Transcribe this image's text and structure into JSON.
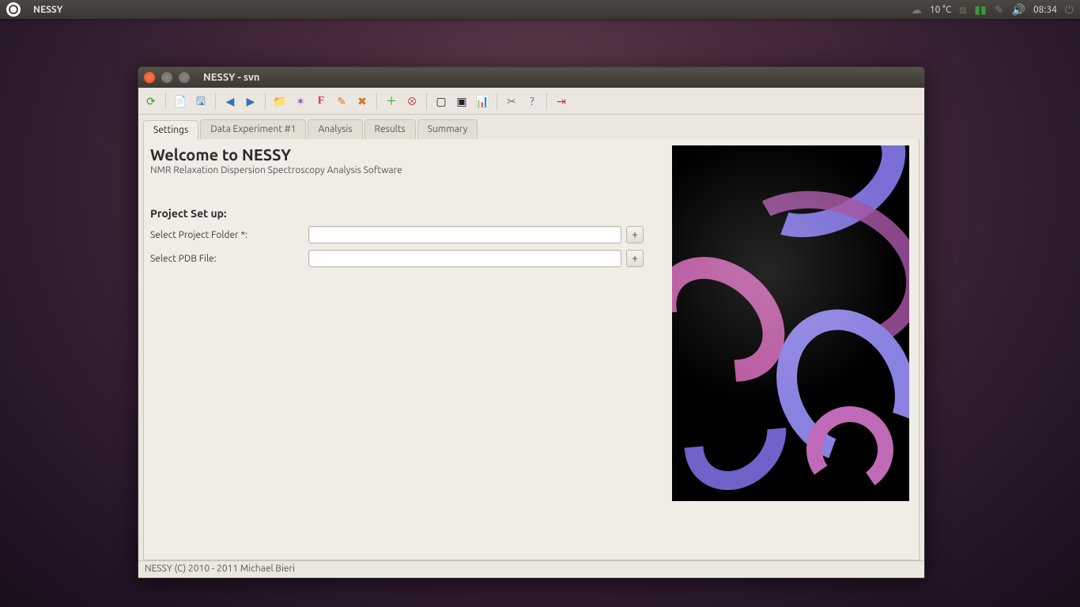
{
  "topbar": {
    "app_name": "NESSY",
    "weather_temp": "10 °C",
    "clock": "08:34"
  },
  "window": {
    "title": "NESSY - svn"
  },
  "tabs": [
    {
      "label": "Settings"
    },
    {
      "label": "Data Experiment #1"
    },
    {
      "label": "Analysis"
    },
    {
      "label": "Results"
    },
    {
      "label": "Summary"
    }
  ],
  "settings_page": {
    "welcome_title": "Welcome to NESSY",
    "welcome_subtitle": "NMR Relaxation Dispersion Spectroscopy Analysis Software",
    "section_title": "Project Set up:",
    "folder_label": "Select Project Folder *:",
    "folder_value": "",
    "pdb_label": "Select PDB File:",
    "pdb_value": "",
    "browse_label": "+"
  },
  "statusbar": {
    "text": "NESSY (C) 2010 - 2011 Michael Bieri"
  }
}
